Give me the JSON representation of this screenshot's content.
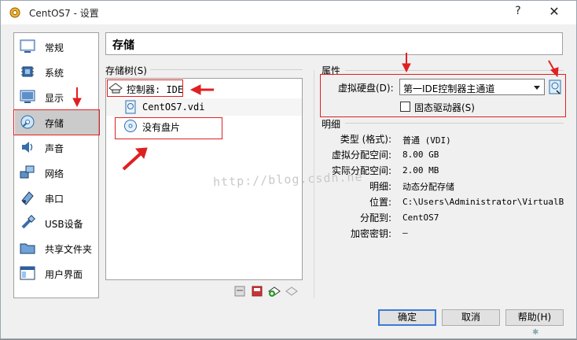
{
  "window": {
    "title": "CentOS7 - 设置",
    "help": "?",
    "close": "✕"
  },
  "nav": [
    {
      "label": "常规",
      "icon": "monitor-icon"
    },
    {
      "label": "系统",
      "icon": "chip-icon"
    },
    {
      "label": "显示",
      "icon": "display-icon"
    },
    {
      "label": "存储",
      "icon": "storage-icon",
      "selected": true
    },
    {
      "label": "声音",
      "icon": "speaker-icon"
    },
    {
      "label": "网络",
      "icon": "network-icon"
    },
    {
      "label": "串口",
      "icon": "serial-icon"
    },
    {
      "label": "USB设备",
      "icon": "usb-icon"
    },
    {
      "label": "共享文件夹",
      "icon": "folder-icon"
    },
    {
      "label": "用户界面",
      "icon": "ui-icon"
    }
  ],
  "page_title": "存储",
  "tree": {
    "label": "存储树(S)",
    "controller": "控制器: IDE",
    "items": [
      "CentOS7.vdi",
      "没有盘片"
    ]
  },
  "attributes": {
    "label": "属性",
    "drive_label": "虚拟硬盘(D):",
    "drive_value": "第一IDE控制器主通道",
    "ssd_label": "固态驱动器(S)"
  },
  "details": {
    "label": "明细",
    "rows": [
      {
        "key": "类型 (格式):",
        "value": "普通 (VDI)"
      },
      {
        "key": "虚拟分配空间:",
        "value": "8.00 GB"
      },
      {
        "key": "实际分配空间:",
        "value": "2.00 MB"
      },
      {
        "key": "明细:",
        "value": "动态分配存储"
      },
      {
        "key": "位置:",
        "value": "C:\\Users\\Administrator\\VirtualBo…"
      },
      {
        "key": "分配到:",
        "value": "CentOS7"
      },
      {
        "key": "加密密钥:",
        "value": "—"
      }
    ]
  },
  "buttons": {
    "ok": "确定",
    "cancel": "取消",
    "help": "帮助(H)"
  },
  "watermark": "http://blog.csdn.ne",
  "colors": {
    "accent": "#3a7bd5",
    "annotation": "#e02020"
  }
}
